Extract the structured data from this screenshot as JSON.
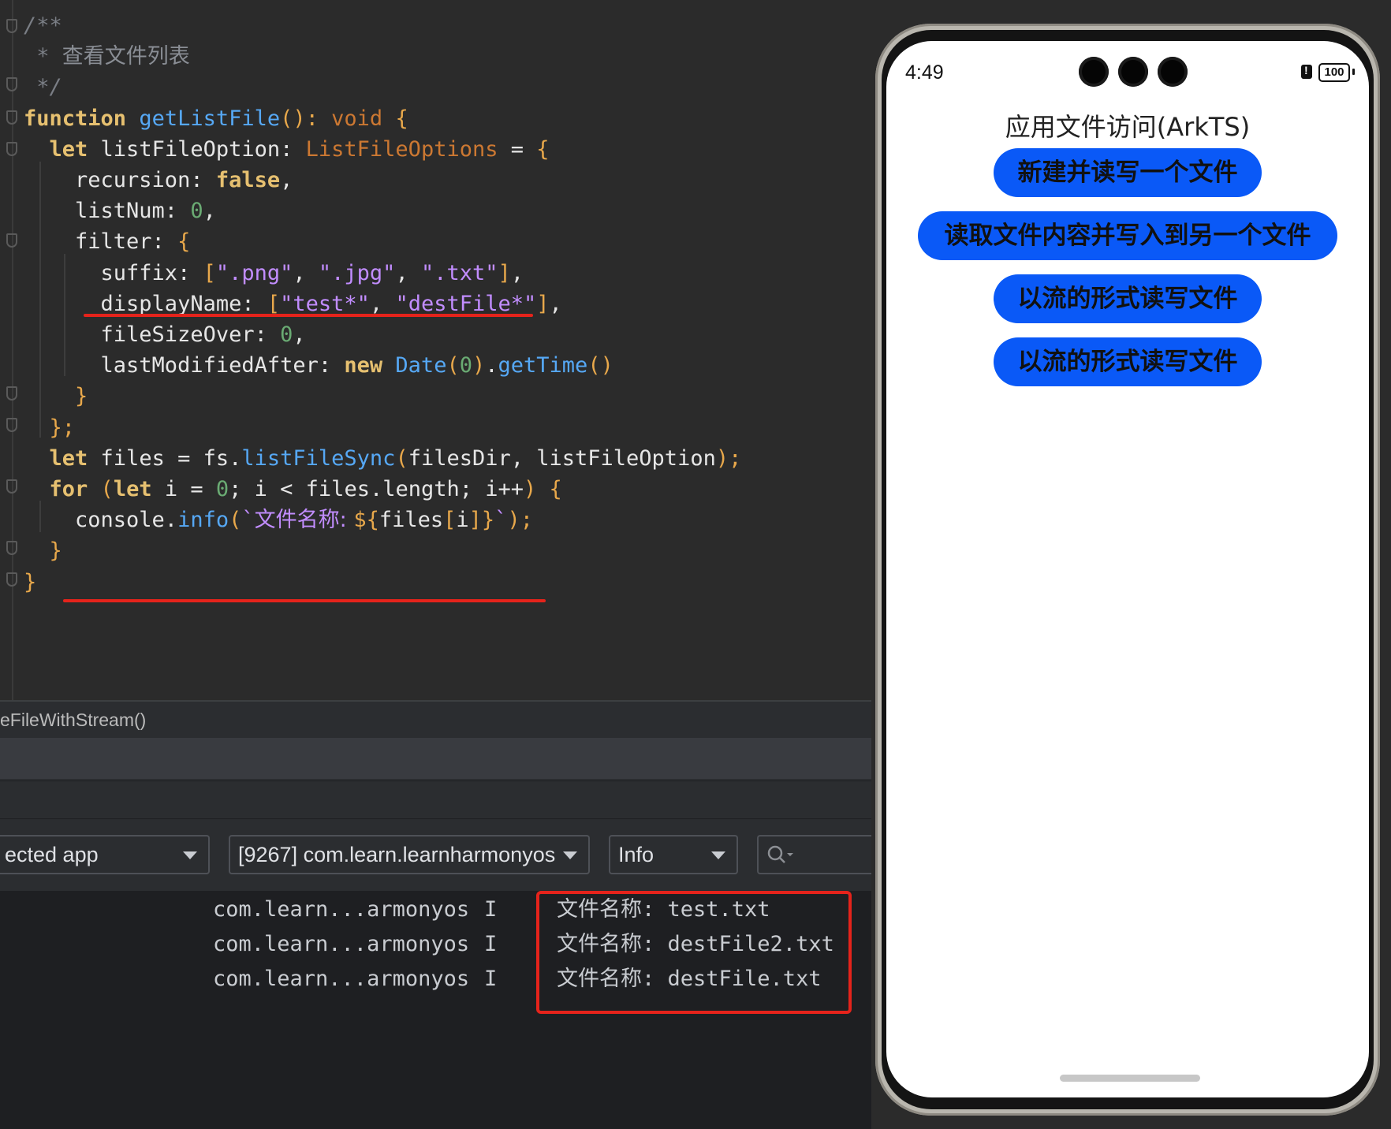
{
  "editor": {
    "lines": [
      {
        "parts": [
          {
            "t": "/**",
            "c": "cm"
          }
        ]
      },
      {
        "parts": [
          {
            "t": " * ",
            "c": "cm"
          },
          {
            "t": "查看文件列表",
            "c": "cm-cn"
          }
        ]
      },
      {
        "parts": [
          {
            "t": " */",
            "c": "cm"
          }
        ]
      },
      {
        "parts": [
          {
            "t": "function ",
            "c": "kw2"
          },
          {
            "t": "getListFile",
            "c": "fn"
          },
          {
            "t": "(): ",
            "c": "br"
          },
          {
            "t": "void ",
            "c": "ty"
          },
          {
            "t": "{",
            "c": "br"
          }
        ]
      },
      {
        "parts": [
          {
            "t": "  let ",
            "c": "kw2"
          },
          {
            "t": "listFileOption",
            "c": ""
          },
          {
            "t": ": ",
            "c": ""
          },
          {
            "t": "ListFileOptions",
            "c": "ty"
          },
          {
            "t": " = ",
            "c": ""
          },
          {
            "t": "{",
            "c": "br"
          }
        ]
      },
      {
        "parts": [
          {
            "t": "    recursion: ",
            "c": ""
          },
          {
            "t": "false",
            "c": "kw2"
          },
          {
            "t": ",",
            "c": ""
          }
        ]
      },
      {
        "parts": [
          {
            "t": "    listNum: ",
            "c": ""
          },
          {
            "t": "0",
            "c": "num"
          },
          {
            "t": ",",
            "c": ""
          }
        ]
      },
      {
        "parts": [
          {
            "t": "    filter: ",
            "c": ""
          },
          {
            "t": "{",
            "c": "br"
          }
        ]
      },
      {
        "parts": [
          {
            "t": "      suffix: ",
            "c": ""
          },
          {
            "t": "[",
            "c": "br"
          },
          {
            "t": "\".png\"",
            "c": "str"
          },
          {
            "t": ", ",
            "c": ""
          },
          {
            "t": "\".jpg\"",
            "c": "str"
          },
          {
            "t": ", ",
            "c": ""
          },
          {
            "t": "\".txt\"",
            "c": "str"
          },
          {
            "t": "]",
            "c": "br"
          },
          {
            "t": ",",
            "c": ""
          }
        ]
      },
      {
        "parts": [
          {
            "t": "      displayName: ",
            "c": ""
          },
          {
            "t": "[",
            "c": "br"
          },
          {
            "t": "\"test*\"",
            "c": "str"
          },
          {
            "t": ", ",
            "c": ""
          },
          {
            "t": "\"destFile*\"",
            "c": "str"
          },
          {
            "t": "]",
            "c": "br"
          },
          {
            "t": ",",
            "c": ""
          }
        ]
      },
      {
        "parts": [
          {
            "t": "      fileSizeOver: ",
            "c": ""
          },
          {
            "t": "0",
            "c": "num"
          },
          {
            "t": ",",
            "c": ""
          }
        ]
      },
      {
        "parts": [
          {
            "t": "      lastModifiedAfter: ",
            "c": ""
          },
          {
            "t": "new ",
            "c": "kw2"
          },
          {
            "t": "Date",
            "c": "fn"
          },
          {
            "t": "(",
            "c": "br"
          },
          {
            "t": "0",
            "c": "num"
          },
          {
            "t": ")",
            "c": "br"
          },
          {
            "t": ".",
            "c": ""
          },
          {
            "t": "getTime",
            "c": "fn"
          },
          {
            "t": "()",
            "c": "br"
          }
        ]
      },
      {
        "parts": [
          {
            "t": "    }",
            "c": "br"
          }
        ]
      },
      {
        "parts": [
          {
            "t": "  };",
            "c": "br"
          }
        ]
      },
      {
        "parts": [
          {
            "t": "  let ",
            "c": "kw2"
          },
          {
            "t": "files = fs.",
            "c": ""
          },
          {
            "t": "listFileSync",
            "c": "fn"
          },
          {
            "t": "(",
            "c": "br"
          },
          {
            "t": "filesDir, listFileOption",
            "c": ""
          },
          {
            "t": ");",
            "c": "br"
          }
        ]
      },
      {
        "parts": [
          {
            "t": "  for ",
            "c": "kw2"
          },
          {
            "t": "(",
            "c": "br"
          },
          {
            "t": "let ",
            "c": "kw2"
          },
          {
            "t": "i = ",
            "c": ""
          },
          {
            "t": "0",
            "c": "num"
          },
          {
            "t": "; i < files.length; i++",
            "c": ""
          },
          {
            "t": ") {",
            "c": "br"
          }
        ]
      },
      {
        "parts": [
          {
            "t": "    console.",
            "c": ""
          },
          {
            "t": "info",
            "c": "fn"
          },
          {
            "t": "(",
            "c": "br"
          },
          {
            "t": "`",
            "c": "str"
          },
          {
            "t": "文件名称: ",
            "c": "str cn"
          },
          {
            "t": "${",
            "c": "br"
          },
          {
            "t": "files",
            "c": ""
          },
          {
            "t": "[",
            "c": "br"
          },
          {
            "t": "i",
            "c": ""
          },
          {
            "t": "]}",
            "c": "br"
          },
          {
            "t": "`",
            "c": "str"
          },
          {
            "t": ");",
            "c": "br"
          }
        ]
      },
      {
        "parts": [
          {
            "t": "  }",
            "c": "br"
          }
        ]
      },
      {
        "parts": [
          {
            "t": "}",
            "c": "br"
          }
        ]
      }
    ]
  },
  "breadcrumb": "eFileWithStream()",
  "filters": {
    "app_select": "ected app",
    "process_select": "[9267] com.learn.learnharmonyos",
    "level_select": "Info"
  },
  "log": {
    "rows": [
      {
        "tag": "com.learn...armonyos",
        "level": "I",
        "message": "文件名称: test.txt"
      },
      {
        "tag": "com.learn...armonyos",
        "level": "I",
        "message": "文件名称: destFile2.txt"
      },
      {
        "tag": "com.learn...armonyos",
        "level": "I",
        "message": "文件名称: destFile.txt"
      }
    ]
  },
  "phone": {
    "time": "4:49",
    "battery": "100",
    "app_title": "应用文件访问(ArkTS)",
    "buttons": [
      "新建并读写一个文件",
      "读取文件内容并写入到另一个文件",
      "以流的形式读写文件",
      "以流的形式读写文件"
    ],
    "button_color": "#0a59f7"
  },
  "colors": {
    "highlight": "#e5231b"
  }
}
